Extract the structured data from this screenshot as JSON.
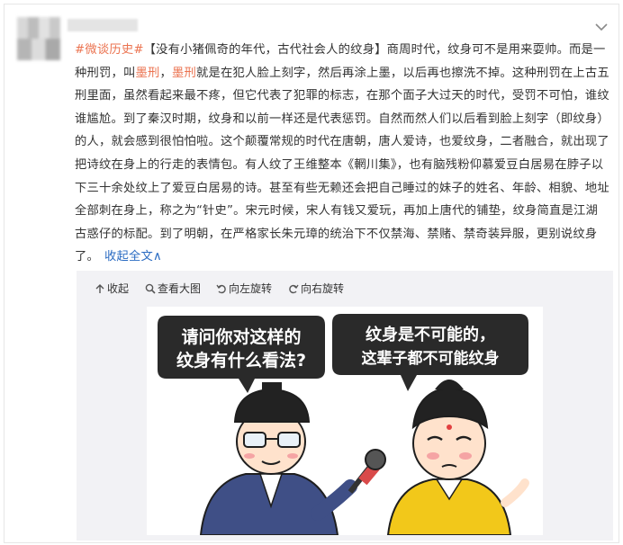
{
  "post": {
    "topic": "#微谈历史#",
    "segments": [
      {
        "t": "【没有小猪佩奇的年代，古代社会人的纹身】商周时代，纹身可不是用来耍帅。而是一种刑罚，叫",
        "c": ""
      },
      {
        "t": "墨刑",
        "c": "lnk"
      },
      {
        "t": "，",
        "c": ""
      },
      {
        "t": "墨刑",
        "c": "lnk"
      },
      {
        "t": "就是在犯人脸上刻字，然后再涂上墨，以后再也擦洗不掉。这种刑罚在上古五刑里面，虽然看起来最不疼，但它代表了犯罪的标志，在那个面子大过天的时代，受罚不可怕，谁纹谁尴尬。到了秦汉时期，纹身和以前一样还是代表惩罚。自然而然人们以后看到脸上刻字（即纹身）的人，就会感到很怕怕啦。这个颠覆常规的时代在唐朝，唐人爱诗，也爱纹身，二者融合，就出现了把诗纹在身上的行走的表情包。有人纹了王维整本《輞川集》，也有脑残粉仰慕爱豆白居易在脖子以下三十余处纹上了爱豆白居易的诗。甚至有些无赖还会把自己睡过的妹子的姓名、年龄、相貌、地址全部刺在身上，称之为“针史”。宋元时候，宋人有钱又爱玩，再加上唐代的铺垫，纹身简直是江湖古惑仔的标配。到了明朝，在严格家长朱元璋的统治下不仅禁海、禁赌、禁奇装异服，更别说纹身了。",
        "c": ""
      }
    ],
    "collapse_label": "收起全文",
    "collapse_arrow": "∧"
  },
  "toolbar": {
    "collapse": "收起",
    "view_large": "查看大图",
    "rotate_left": "向左旋转",
    "rotate_right": "向右旋转"
  },
  "image": {
    "left_bubble_line1": "请问你对这样的",
    "left_bubble_line2": "纹身有什么看法?",
    "right_bubble_line1": "纹身是不可能的，",
    "right_bubble_line2": "这辈子都不可能纹身",
    "mic_label": "PSTV"
  },
  "colors": {
    "link": "#eb7350",
    "action": "#2a6bc2",
    "bubble": "#2a2a2a",
    "robe_left": "#3f4f86",
    "robe_right": "#f2c81a"
  }
}
